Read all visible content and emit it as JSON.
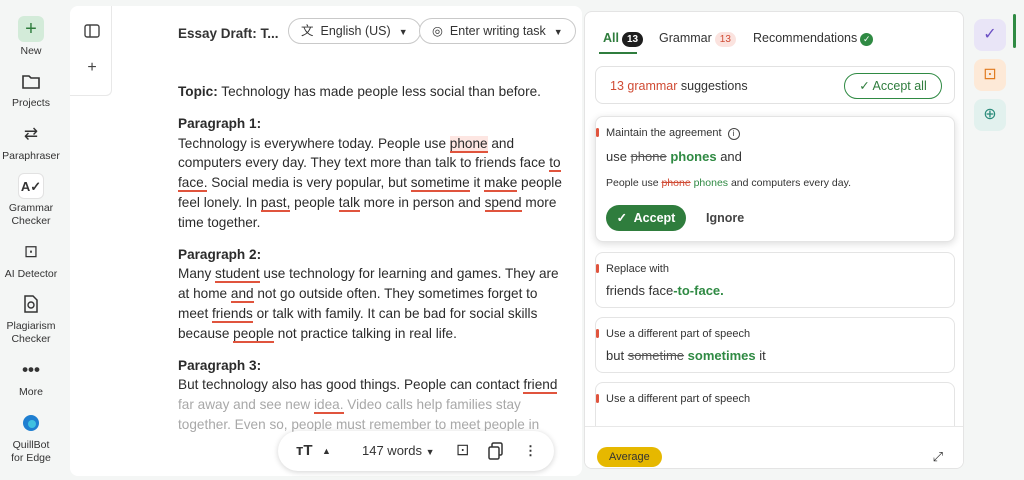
{
  "nav": {
    "items": [
      {
        "label": "New",
        "icon": "plus-icon"
      },
      {
        "label": "Projects",
        "icon": "folder-icon"
      },
      {
        "label": "Paraphraser",
        "icon": "paraphraser-icon"
      },
      {
        "label": "Grammar Checker",
        "icon": "grammar-checker-icon"
      },
      {
        "label": "AI Detector",
        "icon": "ai-detector-icon"
      },
      {
        "label": "Plagiarism Checker",
        "icon": "plagiarism-icon"
      },
      {
        "label": "More",
        "icon": "more-icon"
      },
      {
        "label": "QuillBot for Edge",
        "icon": "edge-icon"
      }
    ]
  },
  "editor": {
    "title": "Essay Draft: T...",
    "language": "English (US)",
    "task": "Enter writing task",
    "topic_label": "Topic:",
    "topic_text": " Technology has made people less social than before.",
    "p1_heading": "Paragraph 1:",
    "p2_heading": "Paragraph 2:",
    "p3_heading": "Paragraph 3:"
  },
  "toolbar": {
    "words": "147 words"
  },
  "panel": {
    "tab_all": "All",
    "tab_all_count": "13",
    "tab_grammar": "Grammar",
    "tab_grammar_count": "13",
    "tab_recommendations": "Recommendations",
    "summary_count": "13 grammar",
    "summary_rest": " suggestions",
    "accept_all": "Accept all",
    "card1": {
      "title": "Maintain the agreement",
      "prefix": "use ",
      "removed": "phone",
      "added": "phones",
      "suffix": " and",
      "context_pre": "People use ",
      "context_removed": "phone",
      "context_added": " phones",
      "context_post": " and computers every day.",
      "accept": "Accept",
      "ignore": "Ignore"
    },
    "card2": {
      "title": "Replace with",
      "prefix": "friends face",
      "added": "-to-face."
    },
    "card3": {
      "title": "Use a different part of speech",
      "prefix": "but ",
      "removed": "sometime",
      "added": "sometimes",
      "suffix": " it"
    },
    "card4": {
      "title": "Use a different part of speech"
    },
    "footer_badge": "Average"
  },
  "colors": {
    "brand_green": "#2f7d3d",
    "error_red": "#e0543d",
    "average_yellow": "#e6b800"
  }
}
